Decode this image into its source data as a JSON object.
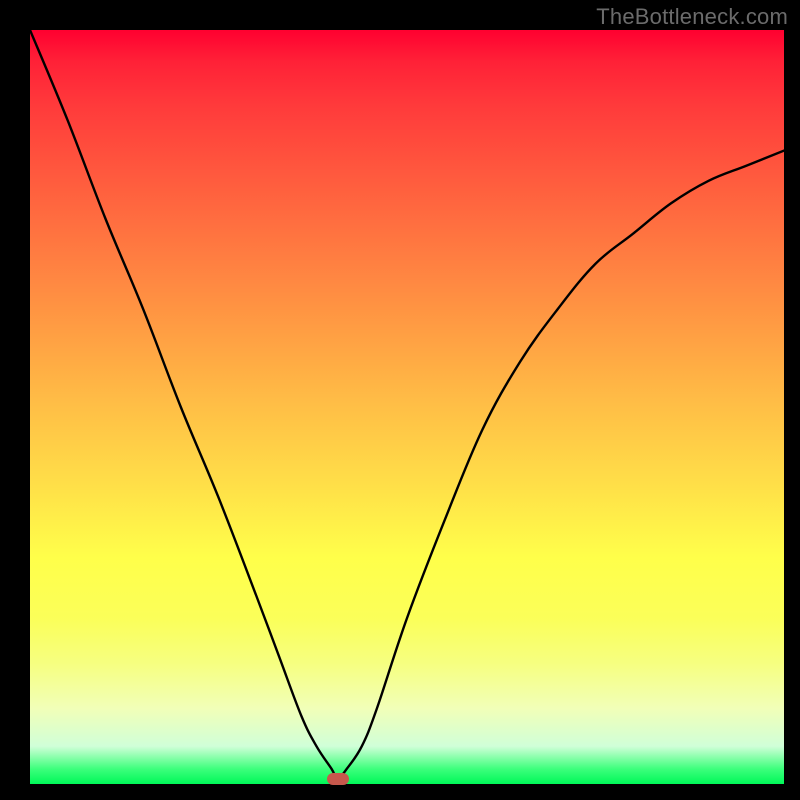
{
  "watermark": "TheBottleneck.com",
  "colors": {
    "frame": "#000000",
    "gradient_top": "#ff0030",
    "gradient_bottom": "#00f858",
    "curve": "#000000",
    "marker": "#c6584c",
    "watermark": "#6b6b6b"
  },
  "marker_position": {
    "x_fraction": 0.408,
    "y_fraction": 0.993
  },
  "chart_data": {
    "type": "line",
    "title": "",
    "xlabel": "",
    "ylabel": "",
    "xlim": [
      0,
      1
    ],
    "ylim": [
      0,
      1
    ],
    "grid": false,
    "legend": false,
    "series": [
      {
        "name": "bottleneck-curve",
        "x": [
          0.0,
          0.05,
          0.1,
          0.15,
          0.2,
          0.25,
          0.3,
          0.33,
          0.36,
          0.38,
          0.4,
          0.408,
          0.42,
          0.44,
          0.46,
          0.5,
          0.55,
          0.6,
          0.65,
          0.7,
          0.75,
          0.8,
          0.85,
          0.9,
          0.95,
          1.0
        ],
        "y": [
          1.0,
          0.88,
          0.75,
          0.63,
          0.5,
          0.38,
          0.25,
          0.17,
          0.09,
          0.05,
          0.02,
          0.007,
          0.02,
          0.05,
          0.1,
          0.22,
          0.35,
          0.47,
          0.56,
          0.63,
          0.69,
          0.73,
          0.77,
          0.8,
          0.82,
          0.84
        ]
      }
    ],
    "marker": {
      "x": 0.408,
      "y": 0.007
    },
    "annotations": [
      "TheBottleneck.com"
    ]
  }
}
